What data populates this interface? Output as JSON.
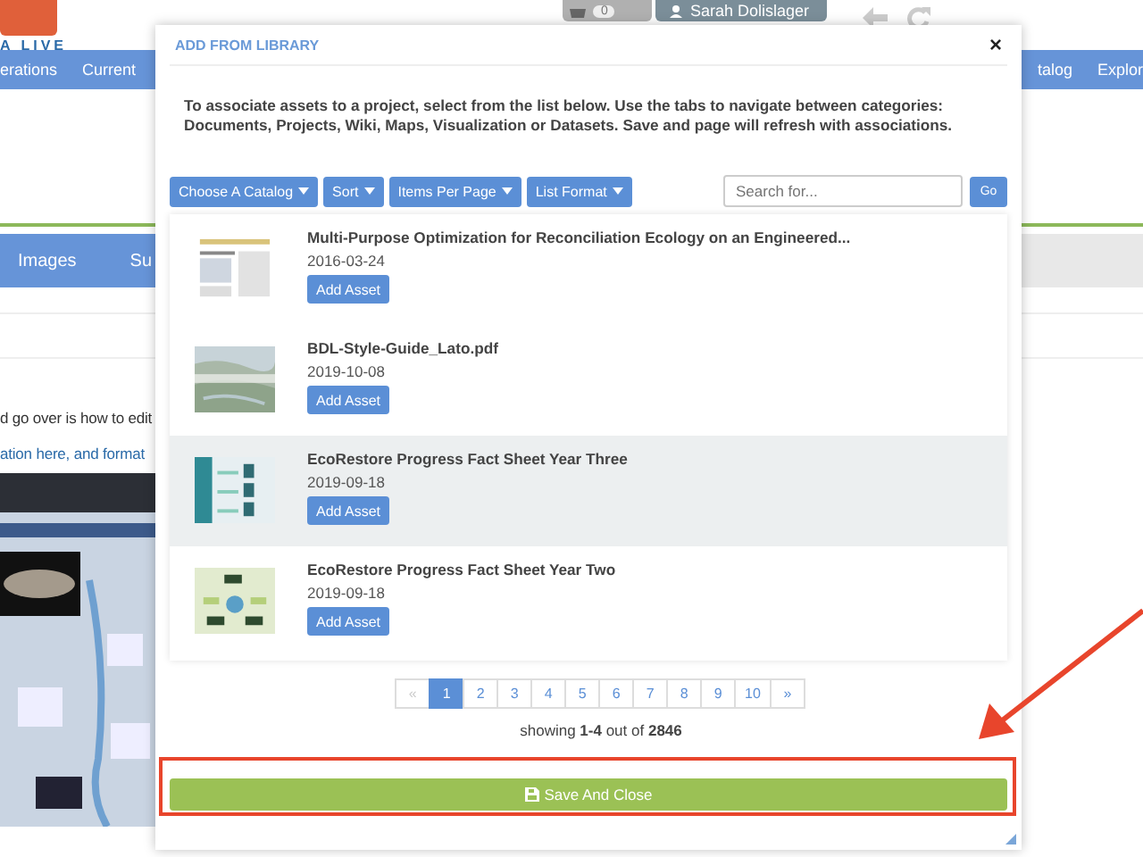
{
  "header": {
    "logo_text": "A LIVE",
    "cart_count": "0",
    "user": "Sarah Dolislager"
  },
  "nav": {
    "left": [
      "erations",
      "Current"
    ],
    "right": [
      "talog",
      "Explor"
    ]
  },
  "tabs": [
    "Images",
    "Su"
  ],
  "body_lines": [
    "d go over is how to edit",
    "ation here, and format"
  ],
  "modal": {
    "title": "ADD FROM LIBRARY",
    "close_label": "×",
    "description": "To associate assets to a project, select from the list below. Use the tabs to navigate between categories: Documents, Projects, Wiki, Maps, Visualization or Datasets. Save and page will refresh with associations.",
    "toolbar": [
      "Choose A Catalog",
      "Sort",
      "Items Per Page",
      "List Format"
    ],
    "search": {
      "placeholder": "Search for..."
    },
    "go": "Go",
    "assets": [
      {
        "title": "Multi-Purpose Optimization for Reconciliation Ecology on an Engineered...",
        "date": "2016-03-24",
        "action": "Add Asset",
        "highlighted": false
      },
      {
        "title": "BDL-Style-Guide_Lato.pdf",
        "date": "2019-10-08",
        "action": "Add Asset",
        "highlighted": false
      },
      {
        "title": "EcoRestore Progress Fact Sheet Year Three",
        "date": "2019-09-18",
        "action": "Add Asset",
        "highlighted": true
      },
      {
        "title": "EcoRestore Progress Fact Sheet Year Two",
        "date": "2019-09-18",
        "action": "Add Asset",
        "highlighted": false
      }
    ],
    "pagination": [
      {
        "label": "«",
        "disabled": true,
        "selected": false
      },
      {
        "label": "1",
        "disabled": false,
        "selected": true
      },
      {
        "label": "2",
        "disabled": false,
        "selected": false
      },
      {
        "label": "3",
        "disabled": false,
        "selected": false
      },
      {
        "label": "4",
        "disabled": false,
        "selected": false
      },
      {
        "label": "5",
        "disabled": false,
        "selected": false
      },
      {
        "label": "6",
        "disabled": false,
        "selected": false
      },
      {
        "label": "7",
        "disabled": false,
        "selected": false
      },
      {
        "label": "8",
        "disabled": false,
        "selected": false
      },
      {
        "label": "9",
        "disabled": false,
        "selected": false
      },
      {
        "label": "10",
        "disabled": false,
        "selected": false
      },
      {
        "label": "»",
        "disabled": false,
        "selected": false
      }
    ],
    "summary": "showing **1-4** out of **2846**",
    "save_button": "Save And Close"
  }
}
